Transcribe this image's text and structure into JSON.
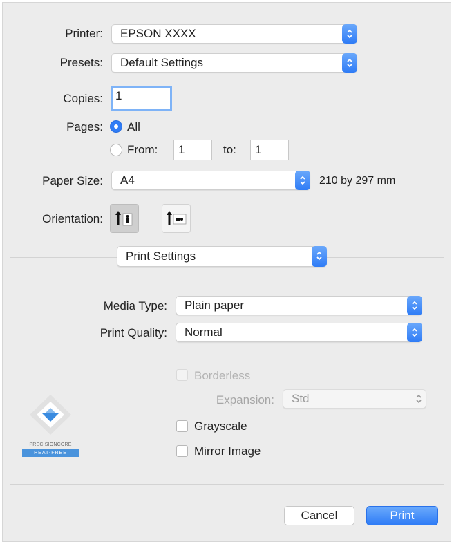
{
  "printer": {
    "label": "Printer:",
    "value": "EPSON XXXX"
  },
  "presets": {
    "label": "Presets:",
    "value": "Default Settings"
  },
  "copies": {
    "label": "Copies:",
    "value": "1"
  },
  "pages": {
    "label": "Pages:",
    "all_label": "All",
    "from_label": "From:",
    "from_value": "1",
    "to_label": "to:",
    "to_value": "1",
    "selected": "All"
  },
  "paper_size": {
    "label": "Paper Size:",
    "value": "A4",
    "dimensions": "210 by 297 mm"
  },
  "orientation": {
    "label": "Orientation:",
    "selected": "portrait"
  },
  "section": {
    "value": "Print Settings"
  },
  "media_type": {
    "label": "Media Type:",
    "value": "Plain paper"
  },
  "print_quality": {
    "label": "Print Quality:",
    "value": "Normal"
  },
  "borderless": {
    "label": "Borderless",
    "checked": false,
    "enabled": false
  },
  "expansion": {
    "label": "Expansion:",
    "value": "Std",
    "enabled": false
  },
  "grayscale": {
    "label": "Grayscale",
    "checked": false
  },
  "mirror_image": {
    "label": "Mirror Image",
    "checked": false
  },
  "logo": {
    "line1": "PRECISIONCORE",
    "line2": "HEAT-FREE"
  },
  "buttons": {
    "cancel": "Cancel",
    "print": "Print"
  },
  "colors": {
    "accent": "#2f7cf6",
    "background": "#ececec"
  }
}
